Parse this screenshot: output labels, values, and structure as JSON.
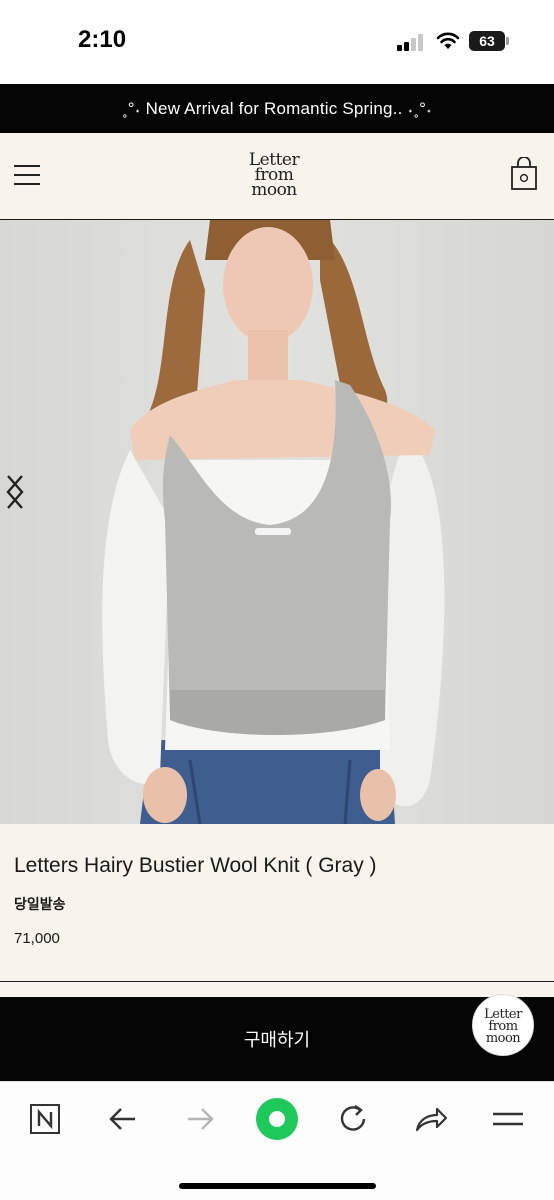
{
  "status_bar": {
    "time": "2:10",
    "battery": "63"
  },
  "announcement": {
    "text": "˳°˖ New Arrival for Romantic Spring.. ˖˳°˖"
  },
  "header": {
    "logo_line1": "Letter",
    "logo_line2": "from",
    "logo_line3": "moon"
  },
  "hero": {
    "image_desc_icon": "product-photo"
  },
  "product": {
    "name": "Letters Hairy Bustier Wool Knit ( Gray )",
    "shipping": "당일발송",
    "price": "71,000"
  },
  "buy_bar": {
    "label": "구매하기"
  },
  "floating_logo": {
    "line1": "Letter",
    "line2": "from",
    "line3": "moon"
  },
  "browser_toolbar": {
    "icons": [
      "naver-icon",
      "back-icon",
      "forward-icon",
      "green-dot-icon",
      "refresh-icon",
      "share-icon",
      "menu-icon"
    ]
  },
  "colors": {
    "accent_green": "#1ec85a",
    "cream": "#f8f3ec",
    "black": "#050505"
  }
}
